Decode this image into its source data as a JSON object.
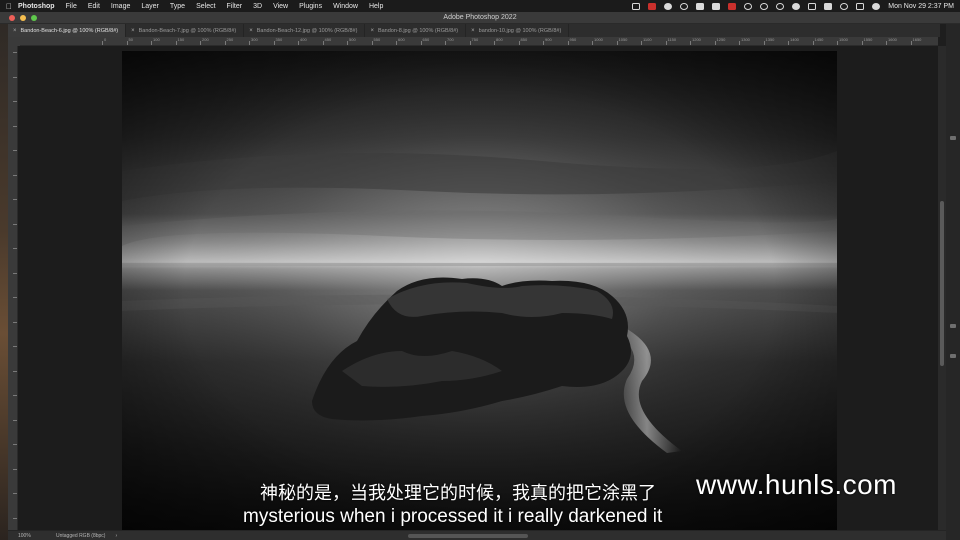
{
  "menubar": {
    "apple_icon": "apple-icon",
    "app_name": "Photoshop",
    "items": [
      "File",
      "Edit",
      "Image",
      "Layer",
      "Type",
      "Select",
      "Filter",
      "3D",
      "View",
      "Plugins",
      "Window",
      "Help"
    ],
    "clock": "Mon Nov 29  2:37 PM"
  },
  "window": {
    "title": "Adobe Photoshop 2022"
  },
  "tabs": [
    {
      "label": "Bandon-Beach-6.jpg @ 100% (RGB/8#)",
      "active": true
    },
    {
      "label": "Bandon-Beach-7.jpg @ 100% (RGB/8#)",
      "active": false
    },
    {
      "label": "Bandon-Beach-12.jpg @ 100% (RGB/8#)",
      "active": false
    },
    {
      "label": "Bandon-8.jpg @ 100% (RGB/8#)",
      "active": false
    },
    {
      "label": "bandon-10.jpg @ 100% (RGB/8#)",
      "active": false
    }
  ],
  "ruler": {
    "labels": [
      "0",
      "50",
      "100",
      "150",
      "200",
      "250",
      "300",
      "350",
      "400",
      "450",
      "500",
      "550",
      "600",
      "650",
      "700",
      "750",
      "800",
      "850",
      "900",
      "950",
      "1000",
      "1050",
      "1100",
      "1150",
      "1200",
      "1250",
      "1300",
      "1350",
      "1400",
      "1450",
      "1500",
      "1550",
      "1600",
      "1650",
      "1700",
      "1750",
      "1800",
      "1850"
    ]
  },
  "status": {
    "zoom": "100%",
    "profile": "Untagged RGB (8bpc)",
    "arrow": "›"
  },
  "overlay": {
    "subtitle_cn": "神秘的是，当我处理它的时候，我真的把它涂黑了",
    "subtitle_en": "mysterious when i processed it i really darkened it",
    "watermark": "www.hunls.com"
  },
  "colors": {
    "menubar_bg": "#1b1b1b",
    "panel_bg": "#3a3a3a",
    "canvas_bg": "#1c1c1c",
    "active_tab": "#3b3b3b"
  }
}
